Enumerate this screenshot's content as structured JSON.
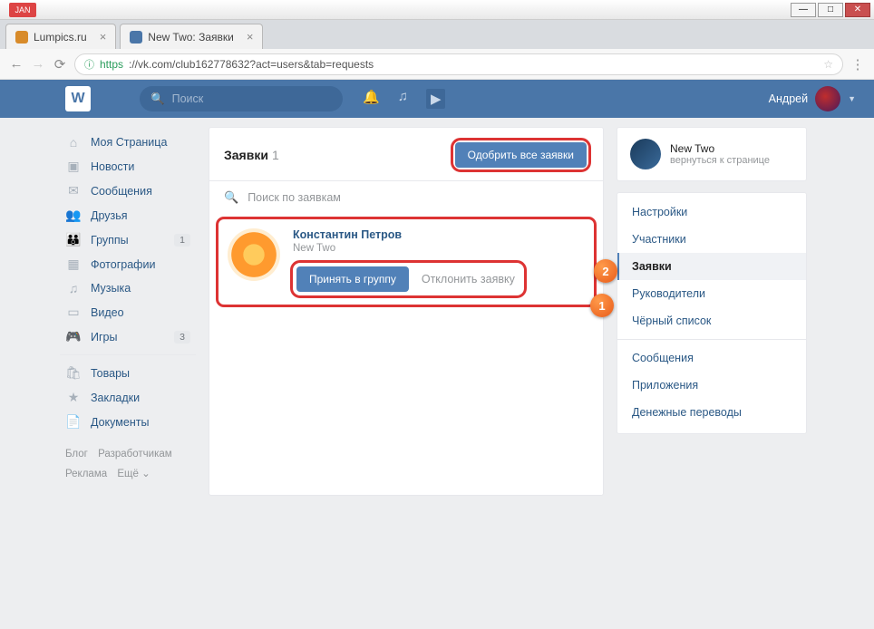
{
  "window": {
    "ext_badge": "JAN"
  },
  "browser_tabs": [
    {
      "title": "Lumpics.ru",
      "fav": "l"
    },
    {
      "title": "New Two: Заявки",
      "fav": "vk"
    }
  ],
  "addressbar": {
    "scheme": "https",
    "url": "://vk.com/club162778632?act=users&tab=requests"
  },
  "vk_header": {
    "search_placeholder": "Поиск",
    "username": "Андрей"
  },
  "left_nav": {
    "items": [
      {
        "icon": "⌂",
        "label": "Моя Страница"
      },
      {
        "icon": "▣",
        "label": "Новости"
      },
      {
        "icon": "✉",
        "label": "Сообщения"
      },
      {
        "icon": "👥",
        "label": "Друзья"
      },
      {
        "icon": "👪",
        "label": "Группы",
        "badge": "1"
      },
      {
        "icon": "▦",
        "label": "Фотографии"
      },
      {
        "icon": "♫",
        "label": "Музыка"
      },
      {
        "icon": "▭",
        "label": "Видео"
      },
      {
        "icon": "🎮",
        "label": "Игры",
        "badge": "3"
      }
    ],
    "items2": [
      {
        "icon": "🛍",
        "label": "Товары"
      },
      {
        "icon": "★",
        "label": "Закладки"
      },
      {
        "icon": "📄",
        "label": "Документы"
      }
    ],
    "footer": [
      "Блог",
      "Разработчикам",
      "Реклама",
      "Ещё ⌄"
    ]
  },
  "main": {
    "title": "Заявки",
    "count": "1",
    "approve_all": "Одобрить все заявки",
    "search_placeholder": "Поиск по заявкам",
    "request": {
      "name": "Константин Петров",
      "subtitle": "New Two",
      "accept": "Принять в группу",
      "decline": "Отклонить заявку"
    },
    "step_labels": {
      "one": "1",
      "two": "2"
    }
  },
  "right": {
    "group_name": "New Two",
    "group_back": "вернуться к странице",
    "menu1": [
      "Настройки",
      "Участники",
      "Заявки",
      "Руководители",
      "Чёрный список"
    ],
    "menu2": [
      "Сообщения",
      "Приложения",
      "Денежные переводы"
    ],
    "active_index": 2
  }
}
